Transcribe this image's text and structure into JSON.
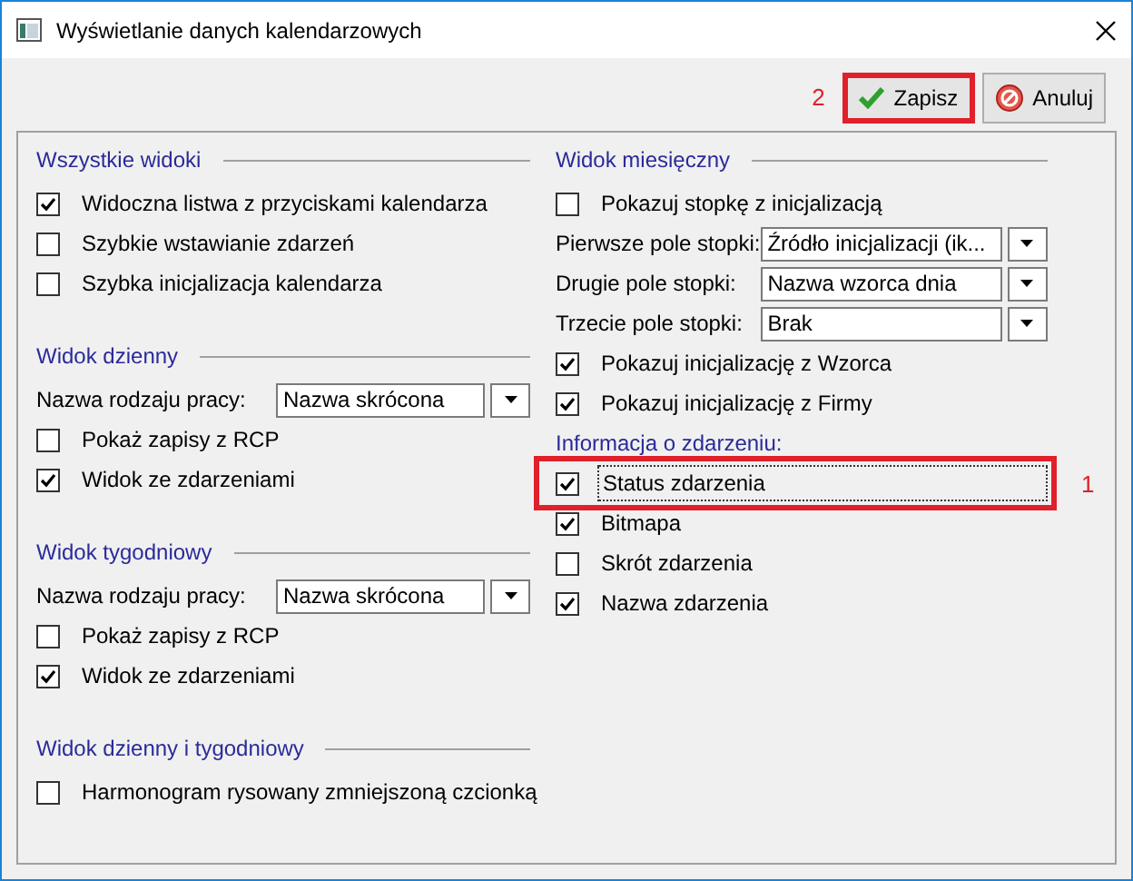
{
  "window": {
    "title": "Wyświetlanie danych kalendarzowych"
  },
  "buttons": [
    {
      "kind": "save",
      "label": "Zapisz",
      "annotation": "2"
    },
    {
      "kind": "cancel",
      "label": "Anuluj"
    }
  ],
  "columns": [
    {
      "sections": [
        {
          "title": "Wszystkie widoki",
          "items": [
            {
              "kind": "checkbox",
              "label": "Widoczna listwa z przyciskami kalendarza",
              "checked": true
            },
            {
              "kind": "checkbox",
              "label": "Szybkie wstawianie zdarzeń",
              "checked": false
            },
            {
              "kind": "checkbox",
              "label": "Szybka inicjalizacja kalendarza",
              "checked": false
            }
          ]
        },
        {
          "title": "Widok dzienny",
          "items": [
            {
              "kind": "combo",
              "label": "Nazwa rodzaju pracy:",
              "value": "Nazwa skrócona"
            },
            {
              "kind": "checkbox",
              "label": "Pokaż zapisy z RCP",
              "checked": false
            },
            {
              "kind": "checkbox",
              "label": "Widok ze zdarzeniami",
              "checked": true
            }
          ]
        },
        {
          "title": "Widok tygodniowy",
          "items": [
            {
              "kind": "combo",
              "label": "Nazwa rodzaju pracy:",
              "value": "Nazwa skrócona"
            },
            {
              "kind": "checkbox",
              "label": "Pokaż zapisy z RCP",
              "checked": false
            },
            {
              "kind": "checkbox",
              "label": "Widok ze zdarzeniami",
              "checked": true
            }
          ]
        },
        {
          "title": "Widok dzienny i tygodniowy",
          "items": [
            {
              "kind": "checkbox",
              "label": "Harmonogram rysowany zmniejszoną czcionką",
              "checked": false
            }
          ]
        }
      ]
    },
    {
      "sections": [
        {
          "title": "Widok miesięczny",
          "items": [
            {
              "kind": "checkbox",
              "label": "Pokazuj stopkę z inicjalizacją",
              "checked": false
            },
            {
              "kind": "combo",
              "label": "Pierwsze pole stopki:",
              "value": "Źródło inicjalizacji (ik..."
            },
            {
              "kind": "combo",
              "label": "Drugie pole stopki:",
              "value": "Nazwa wzorca dnia"
            },
            {
              "kind": "combo",
              "label": "Trzecie pole stopki:",
              "value": "Brak"
            },
            {
              "kind": "checkbox",
              "label": "Pokazuj inicjalizację z Wzorca",
              "checked": true
            },
            {
              "kind": "checkbox",
              "label": "Pokazuj inicjalizację z Firmy",
              "checked": true
            },
            {
              "kind": "label",
              "label": "Informacja o zdarzeniu:"
            },
            {
              "kind": "checkbox",
              "label": "Status zdarzenia",
              "checked": true,
              "annotation": "1"
            },
            {
              "kind": "checkbox",
              "label": "Bitmapa",
              "checked": true
            },
            {
              "kind": "checkbox",
              "label": "Skrót zdarzenia",
              "checked": false
            },
            {
              "kind": "checkbox",
              "label": "Nazwa zdarzenia",
              "checked": true
            }
          ]
        }
      ]
    }
  ]
}
